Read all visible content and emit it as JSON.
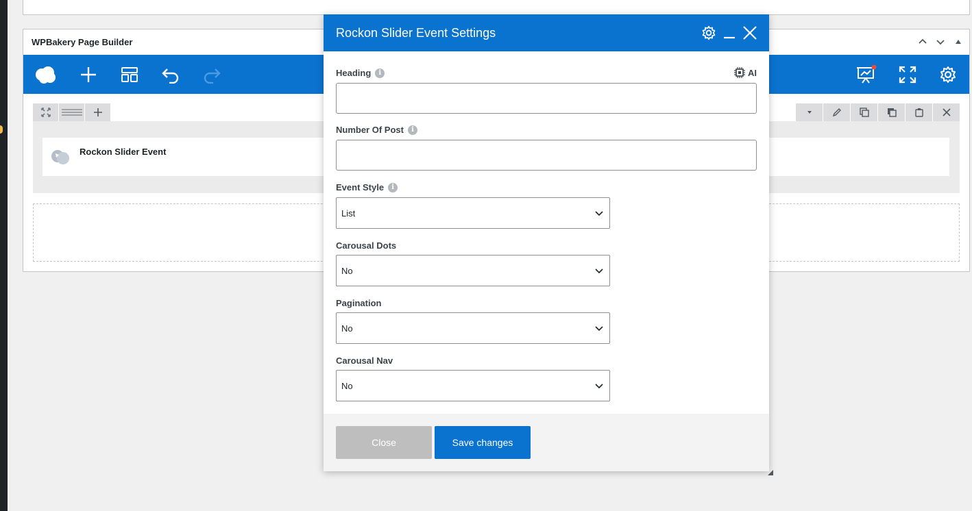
{
  "page": {
    "builder_title": "WPBakery Page Builder",
    "element_name": "Rockon Slider Event"
  },
  "toolbar": {
    "icons": [
      "cloud-icon",
      "plus-icon",
      "layout-icon",
      "undo-icon",
      "redo-icon",
      "preview-icon",
      "fullscreen-icon",
      "settings-icon"
    ],
    "accent": "#0a73cf",
    "notification_color": "#e74c3c"
  },
  "modal": {
    "title": "Rockon Slider Event Settings",
    "ai_label": "AI",
    "fields": {
      "heading": {
        "label": "Heading",
        "value": ""
      },
      "number_of_post": {
        "label": "Number Of Post",
        "value": ""
      },
      "event_style": {
        "label": "Event Style",
        "value": "List"
      },
      "carousal_dots": {
        "label": "Carousal Dots",
        "value": "No"
      },
      "pagination": {
        "label": "Pagination",
        "value": "No"
      },
      "carousal_nav": {
        "label": "Carousal Nav",
        "value": "No"
      }
    },
    "close_label": "Close",
    "save_label": "Save changes"
  }
}
